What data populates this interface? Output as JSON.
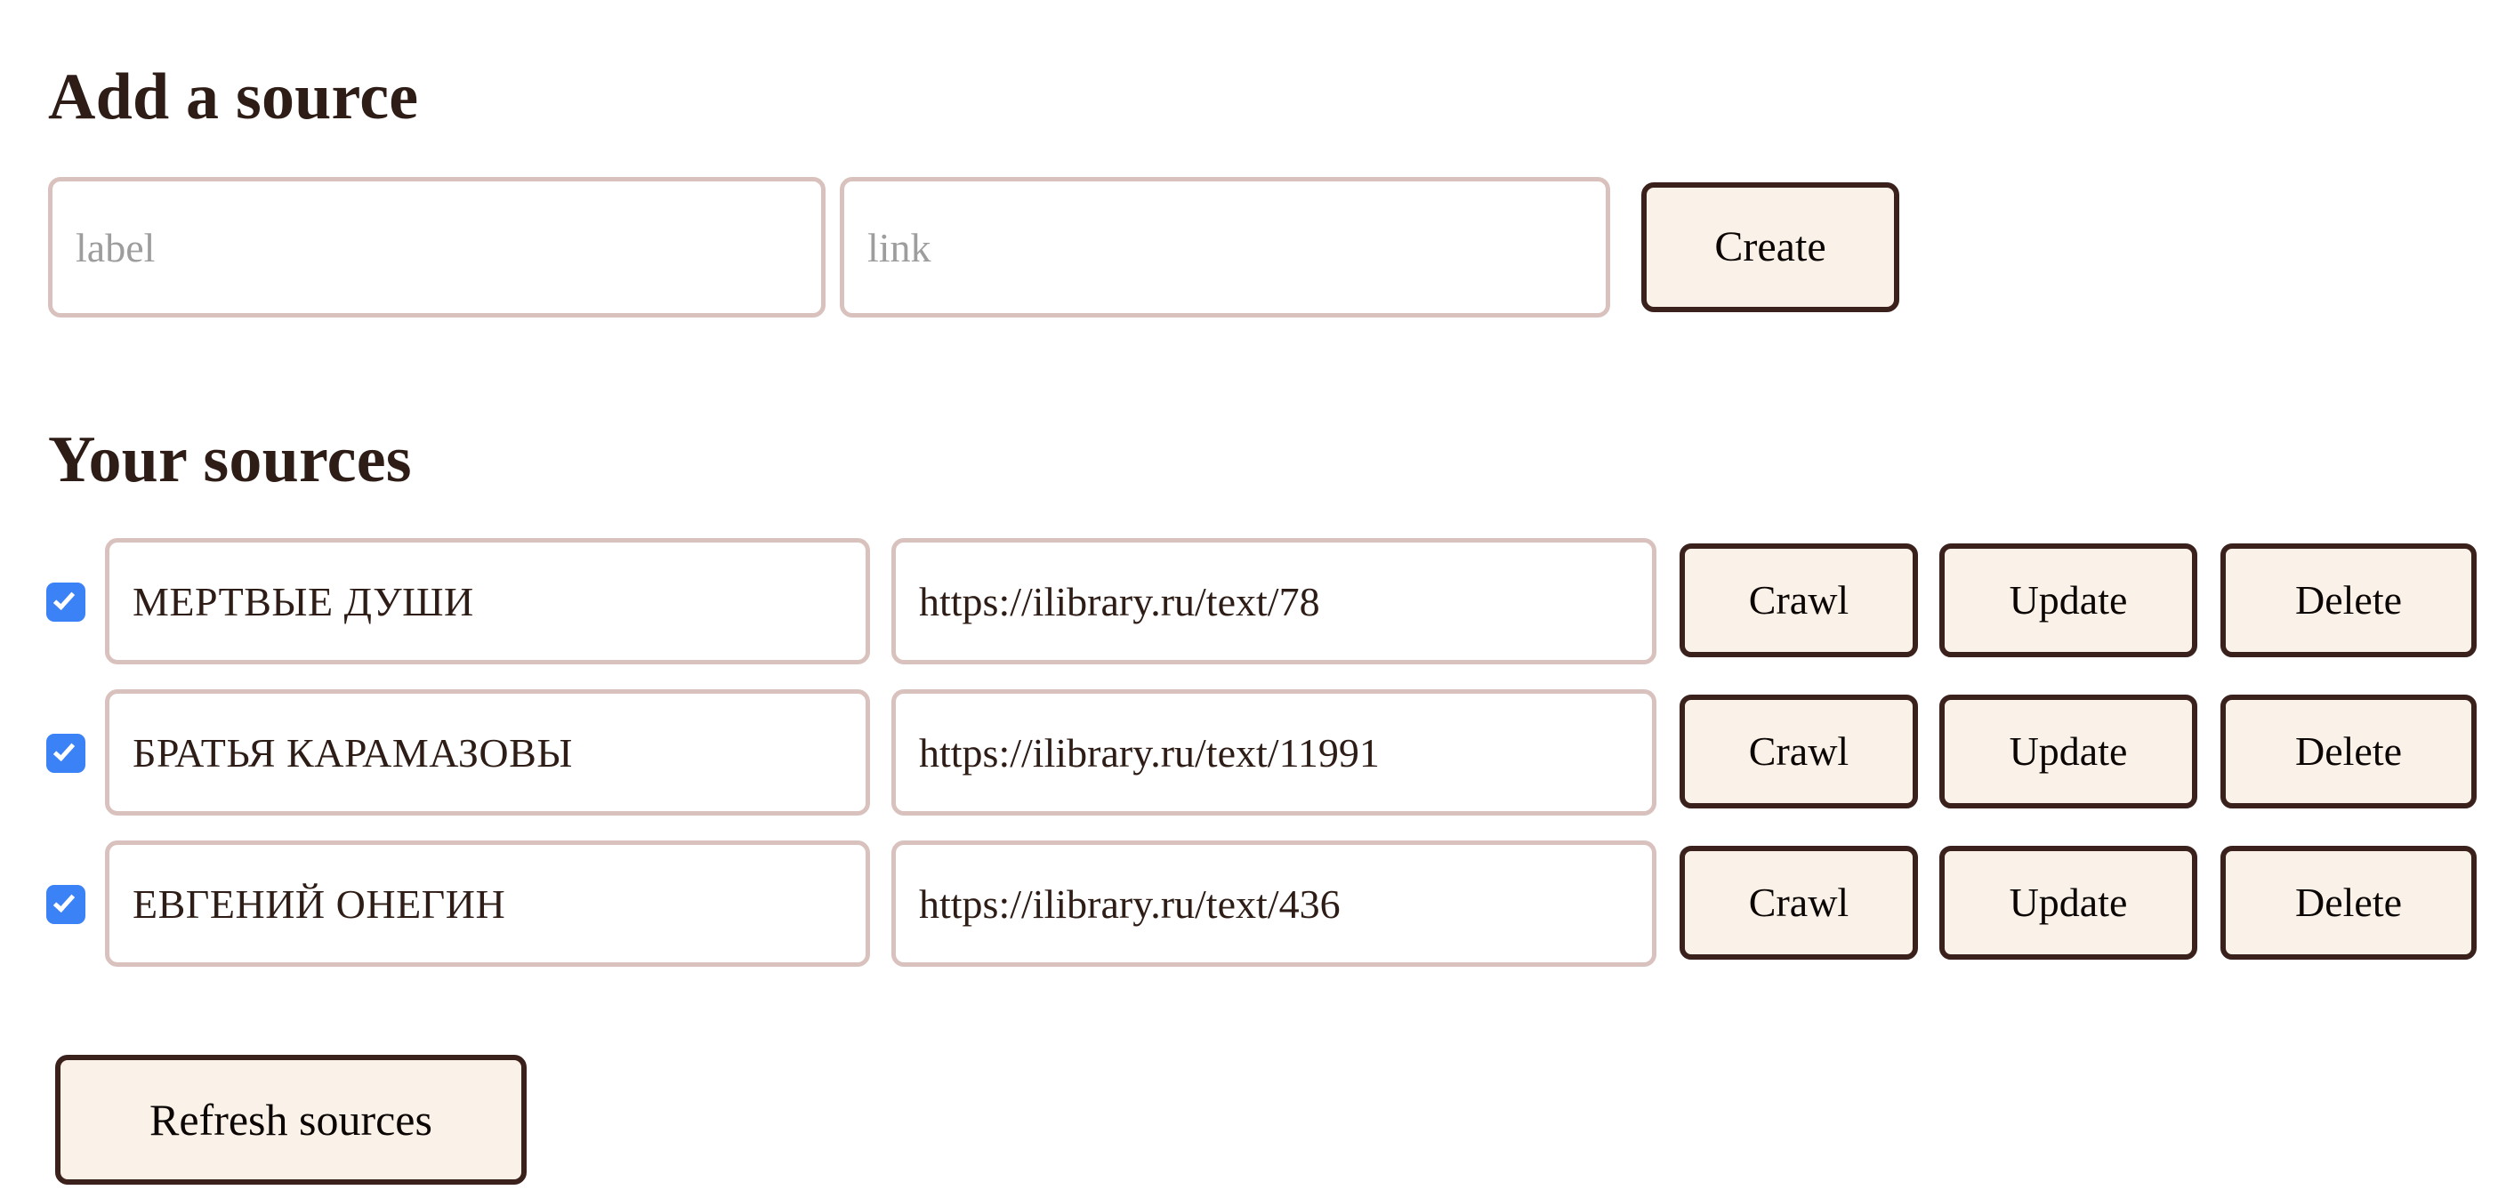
{
  "add_source": {
    "heading": "Add a source",
    "label_placeholder": "label",
    "label_value": "",
    "link_placeholder": "link",
    "link_value": "",
    "create_button": "Create"
  },
  "your_sources": {
    "heading": "Your sources",
    "refresh_button": "Refresh sources",
    "row_actions": {
      "crawl": "Crawl",
      "update": "Update",
      "delete": "Delete"
    },
    "rows": [
      {
        "checked": true,
        "label": "МЕРТВЫЕ ДУШИ",
        "link": "https://ilibrary.ru/text/78",
        "crawl": "Crawl",
        "update": "Update",
        "delete": "Delete"
      },
      {
        "checked": true,
        "label": "БРАТЬЯ КАРАМАЗОВЫ",
        "link": "https://ilibrary.ru/text/11991",
        "crawl": "Crawl",
        "update": "Update",
        "delete": "Delete"
      },
      {
        "checked": true,
        "label": "ЕВГЕНИЙ ОНЕГИН",
        "link": "https://ilibrary.ru/text/436",
        "crawl": "Crawl",
        "update": "Update",
        "delete": "Delete"
      }
    ]
  },
  "colors": {
    "text": "#2e1d16",
    "input_border": "#d9c2bd",
    "button_fill": "#faf2e9",
    "button_border": "#3a211c",
    "checkbox_accent": "#3b82f6",
    "placeholder": "#9d9d9d",
    "background": "#ffffff"
  }
}
